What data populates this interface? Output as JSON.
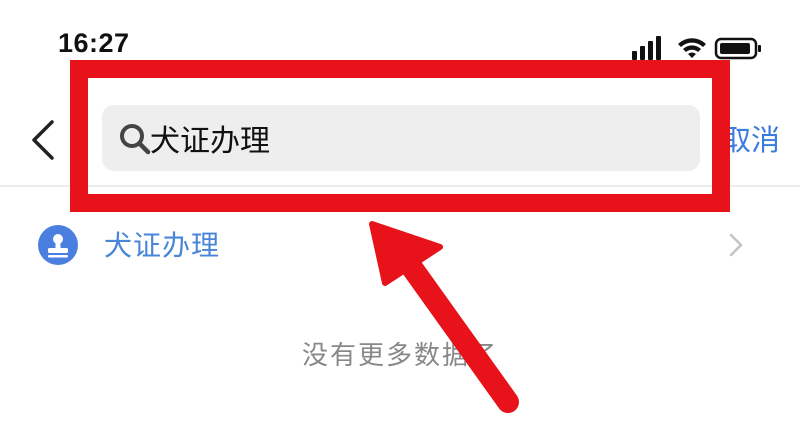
{
  "status_bar": {
    "time": "16:27",
    "icons": [
      "signal-icon",
      "wifi-icon",
      "battery-icon"
    ]
  },
  "header": {
    "back_icon": "chevron-left-icon",
    "search": {
      "icon": "search-icon",
      "value": "犬证办理",
      "placeholder": ""
    },
    "cancel_label": "取消"
  },
  "results": [
    {
      "icon": "stamp-icon",
      "label": "犬证办理",
      "chevron": "chevron-right-icon"
    }
  ],
  "no_more_text": "没有更多数据了",
  "annotation": {
    "highlight_color": "#e8131a",
    "arrow_color": "#e8131a"
  },
  "colors": {
    "accent": "#3a7be0",
    "result_text": "#4a86d8",
    "search_bg": "#eeeeee",
    "muted_text": "#888888"
  }
}
